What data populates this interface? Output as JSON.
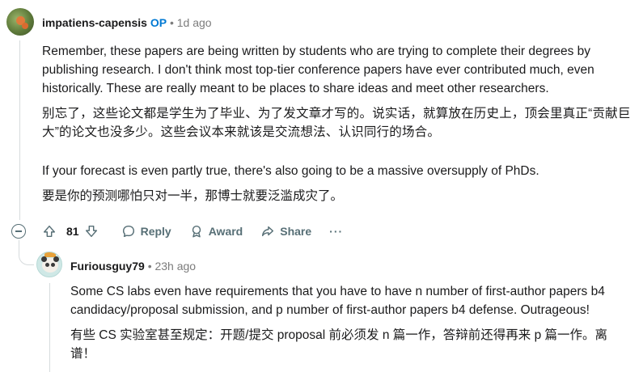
{
  "op_comment": {
    "username": "impatiens-capensis",
    "op_badge": "OP",
    "separator": "•",
    "time": "1d ago",
    "paragraphs": [
      "Remember, these papers are being written by students who are trying to complete their degrees by publishing research. I don't think most top-tier conference papers have ever contributed much, even historically. These are really meant to be places to share ideas and meet other researchers.",
      "别忘了，这些论文都是学生为了毕业、为了发文章才写的。说实话，就算放在历史上，顶会里真正“贡献巨大”的论文也没多少。这些会议本来就该是交流想法、认识同行的场合。",
      "If your forecast is even partly true, there's also going to be a massive oversupply of PhDs.",
      "要是你的预测哪怕只对一半，那博士就要泛滥成灾了。"
    ],
    "actions": {
      "score": "81",
      "reply": "Reply",
      "award": "Award",
      "share": "Share",
      "more": "···"
    }
  },
  "reply_comment": {
    "username": "Furiousguy79",
    "separator": "•",
    "time": "23h ago",
    "paragraphs": [
      "Some CS labs even have requirements that you have to have n number of first-author papers b4 candidacy/proposal submission, and p number of first-author papers b4 defense. Outrageous!",
      "有些 CS 实验室甚至规定：开题/提交 proposal 前必须发 n 篇一作，答辩前还得再来 p 篇一作。离谱！"
    ]
  }
}
